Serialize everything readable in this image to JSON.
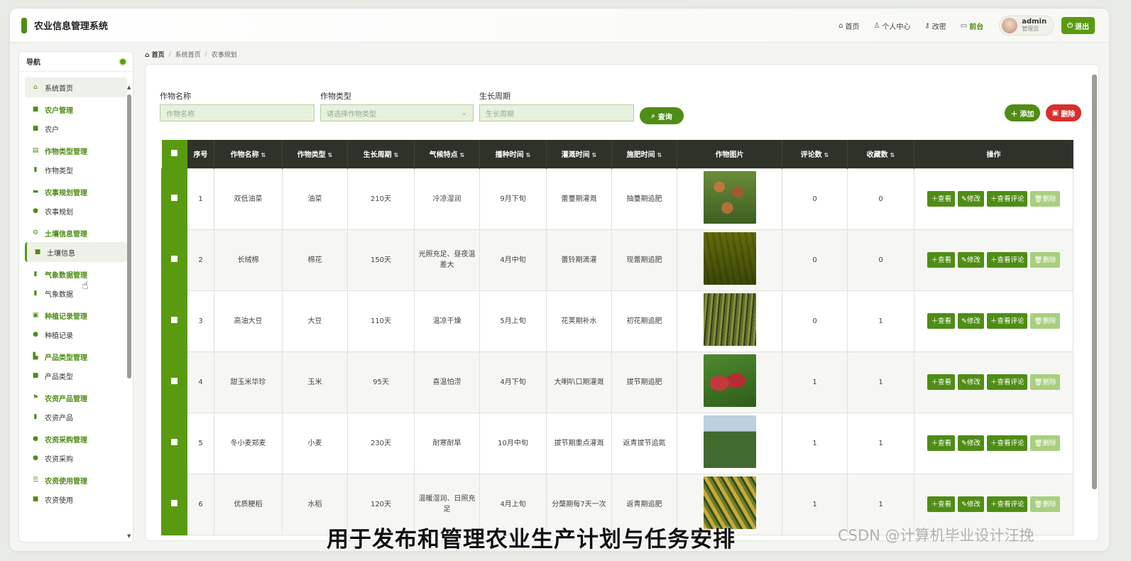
{
  "app": {
    "title": "农业信息管理系统"
  },
  "topnav": {
    "items": [
      {
        "icon": "home-icon",
        "label": "首页"
      },
      {
        "icon": "user-icon",
        "label": "个人中心"
      },
      {
        "icon": "key-icon",
        "label": "改密"
      },
      {
        "icon": "monitor-icon",
        "label": "前台"
      }
    ],
    "user_name": "admin",
    "user_role": "管理员",
    "logout_label": "退出"
  },
  "sidebar": {
    "header": "导航",
    "home_item": "系统首页",
    "groups": [
      {
        "title": "农户管理",
        "items": [
          "农户"
        ]
      },
      {
        "title": "作物类型管理",
        "items": [
          "作物类型"
        ]
      },
      {
        "title": "农事规划管理",
        "items": [
          "农事规划"
        ]
      },
      {
        "title": "土壤信息管理",
        "items": [
          "土壤信息"
        ]
      },
      {
        "title": "气象数据管理",
        "items": [
          "气象数据"
        ]
      },
      {
        "title": "种植记录管理",
        "items": [
          "种植记录"
        ]
      },
      {
        "title": "产品类型管理",
        "items": [
          "产品类型"
        ]
      },
      {
        "title": "农资产品管理",
        "items": [
          "农资产品"
        ]
      },
      {
        "title": "农资采购管理",
        "items": [
          "农资采购"
        ]
      },
      {
        "title": "农资使用管理",
        "items": [
          "农资使用"
        ]
      }
    ]
  },
  "breadcrumb": {
    "home": "首页",
    "level1": "系统首页",
    "level2": "农事规划"
  },
  "filters": {
    "name_label": "作物名称",
    "name_placeholder": "作物名称",
    "type_label": "作物类型",
    "type_placeholder": "请选择作物类型",
    "cycle_label": "生长周期",
    "cycle_placeholder": "生长周期",
    "query_label": "查询",
    "add_label": "添加",
    "delete_label": "删除"
  },
  "table": {
    "headers": [
      "序号",
      "作物名称",
      "作物类型",
      "生长周期",
      "气候特点",
      "播种时间",
      "灌溉时间",
      "施肥时间",
      "作物图片",
      "评论数",
      "收藏数",
      "操作"
    ],
    "rows": [
      {
        "no": "1",
        "name": "双低油菜",
        "type": "油菜",
        "cycle": "210天",
        "climate": "冷凉湿润",
        "sow": "9月下旬",
        "irrigate": "蕾薹期灌溉",
        "fertilize": "抽薹期追肥",
        "comments": "0",
        "favorites": "0"
      },
      {
        "no": "2",
        "name": "长绒棉",
        "type": "棉花",
        "cycle": "150天",
        "climate": "光照充足、昼夜温差大",
        "sow": "4月中旬",
        "irrigate": "蕾铃期滴灌",
        "fertilize": "现蕾期追肥",
        "comments": "0",
        "favorites": "0"
      },
      {
        "no": "3",
        "name": "高油大豆",
        "type": "大豆",
        "cycle": "110天",
        "climate": "温凉干燥",
        "sow": "5月上旬",
        "irrigate": "花荚期补水",
        "fertilize": "初花期追肥",
        "comments": "0",
        "favorites": "1"
      },
      {
        "no": "4",
        "name": "甜玉米华珍",
        "type": "玉米",
        "cycle": "95天",
        "climate": "喜温怕涝",
        "sow": "4月下旬",
        "irrigate": "大喇叭口期灌溉",
        "fertilize": "拔节期追肥",
        "comments": "1",
        "favorites": "1"
      },
      {
        "no": "5",
        "name": "冬小麦郑麦",
        "type": "小麦",
        "cycle": "230天",
        "climate": "耐寒耐旱",
        "sow": "10月中旬",
        "irrigate": "拔节期重点灌溉",
        "fertilize": "返青拔节追氮",
        "comments": "1",
        "favorites": "1"
      },
      {
        "no": "6",
        "name": "优质粳稻",
        "type": "水稻",
        "cycle": "120天",
        "climate": "温暖湿润、日照充足",
        "sow": "4月上旬",
        "irrigate": "分蘖期每7天一次",
        "fertilize": "返青期追肥",
        "comments": "1",
        "favorites": "1"
      }
    ],
    "ops": {
      "view": "查看",
      "edit": "修改",
      "view_comments": "查看评论",
      "delete": "删除"
    }
  },
  "caption": "用于发布和管理农业生产计划与任务安排",
  "watermark": "CSDN @计算机毕业设计汪挽",
  "colors": {
    "primary": "#4f8d16",
    "danger": "#d82e2e",
    "table_header": "#2f3229"
  }
}
